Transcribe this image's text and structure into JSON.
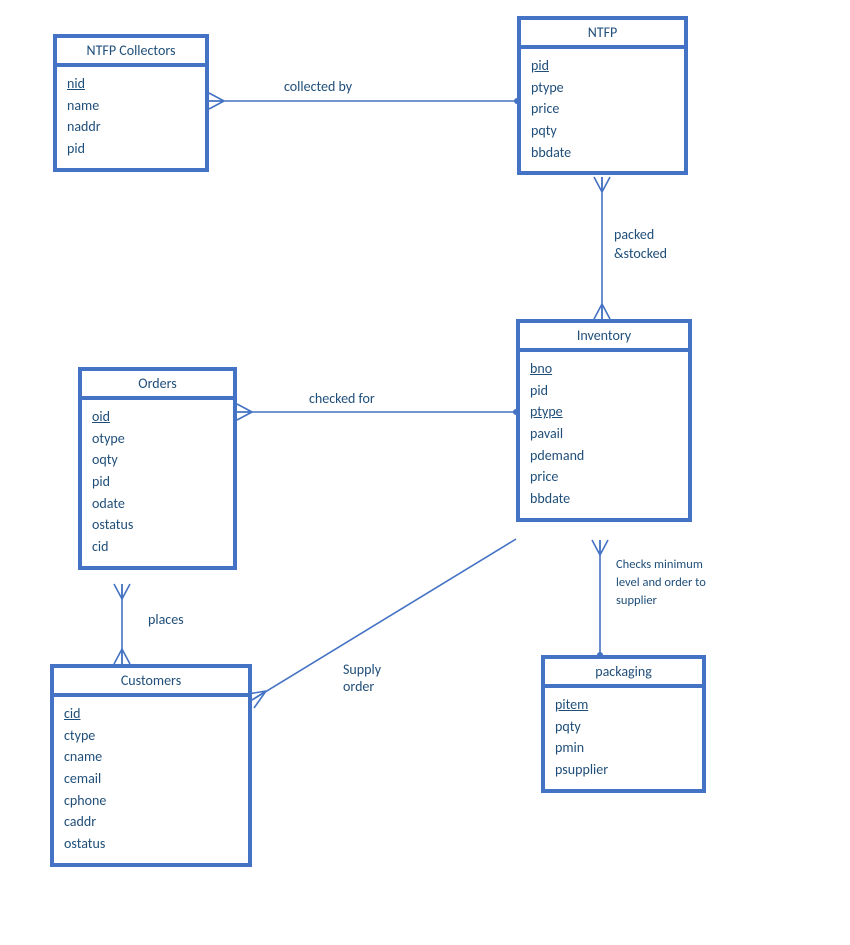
{
  "entities": {
    "ntfp_collectors": {
      "title": "NTFP Collectors",
      "attrs": [
        {
          "name": "nid",
          "key": true
        },
        {
          "name": "name",
          "key": false
        },
        {
          "name": "naddr",
          "key": false
        },
        {
          "name": "pid",
          "key": false
        }
      ]
    },
    "ntfp": {
      "title": "NTFP",
      "attrs": [
        {
          "name": "pid",
          "key": true
        },
        {
          "name": "ptype",
          "key": false
        },
        {
          "name": "price",
          "key": false
        },
        {
          "name": "pqty",
          "key": false
        },
        {
          "name": "bbdate",
          "key": false
        }
      ]
    },
    "orders": {
      "title": "Orders",
      "attrs": [
        {
          "name": "oid",
          "key": true
        },
        {
          "name": "otype",
          "key": false
        },
        {
          "name": "oqty",
          "key": false
        },
        {
          "name": "pid",
          "key": false
        },
        {
          "name": "odate",
          "key": false
        },
        {
          "name": "ostatus",
          "key": false
        },
        {
          "name": "cid",
          "key": false
        }
      ]
    },
    "inventory": {
      "title": "Inventory",
      "attrs": [
        {
          "name": "bno",
          "key": true
        },
        {
          "name": "pid",
          "key": false
        },
        {
          "name": "ptype",
          "key": true
        },
        {
          "name": "pavail",
          "key": false
        },
        {
          "name": "pdemand",
          "key": false
        },
        {
          "name": "price",
          "key": false
        },
        {
          "name": "bbdate",
          "key": false
        }
      ]
    },
    "customers": {
      "title": "Customers",
      "attrs": [
        {
          "name": "cid",
          "key": true
        },
        {
          "name": "ctype",
          "key": false
        },
        {
          "name": "cname",
          "key": false
        },
        {
          "name": "cemail",
          "key": false
        },
        {
          "name": "cphone",
          "key": false
        },
        {
          "name": "caddr",
          "key": false
        },
        {
          "name": "ostatus",
          "key": false
        }
      ]
    },
    "packaging": {
      "title": "packaging",
      "attrs": [
        {
          "name": "pitem",
          "key": true
        },
        {
          "name": "pqty",
          "key": false
        },
        {
          "name": "pmin",
          "key": false
        },
        {
          "name": "psupplier",
          "key": false
        }
      ]
    }
  },
  "relationships": {
    "collected_by": "collected by",
    "packed_stocked_l1": "packed",
    "packed_stocked_l2": "&stocked",
    "checked_for": "checked for",
    "places": "places",
    "supply_order": "Supply\norder",
    "checks_minimum_l1": "Checks minimum",
    "checks_minimum_l2": "level and order to",
    "checks_minimum_l3": "supplier"
  }
}
